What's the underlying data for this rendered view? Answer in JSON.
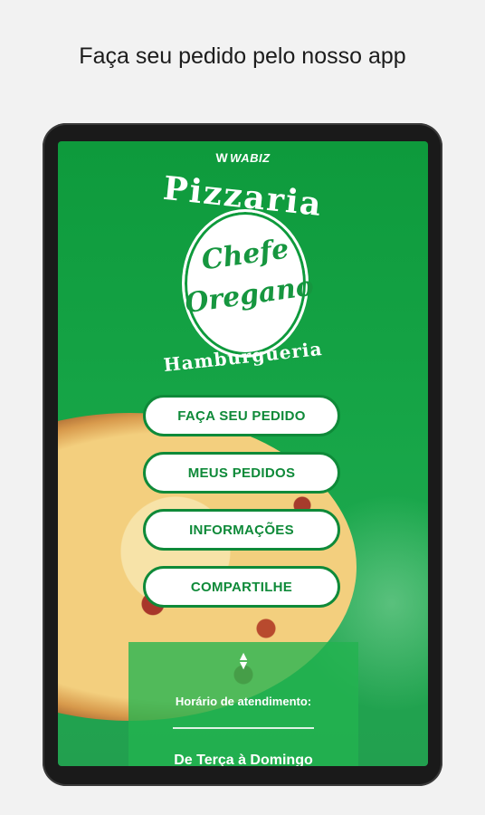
{
  "headline": "Faça seu pedido pelo nosso app",
  "brand": {
    "name": "WABIZ",
    "mark": "W"
  },
  "logo": {
    "top_text": "Pizzaria",
    "center_line1": "Chefe",
    "center_line2": "Oregano",
    "bottom_text": "Hamburgueria"
  },
  "menu": [
    {
      "label": "FAÇA SEU PEDIDO"
    },
    {
      "label": "MEUS PEDIDOS"
    },
    {
      "label": "INFORMAÇÕES"
    },
    {
      "label": "COMPARTILHE"
    }
  ],
  "info": {
    "toggle_icon": "up-down-arrows-icon",
    "hours_label": "Horário de atendimento:",
    "days": "De Terça à Domingo"
  },
  "colors": {
    "accent_green": "#0f8a39",
    "background_green": "#16a547",
    "button_bg": "#ffffff"
  }
}
